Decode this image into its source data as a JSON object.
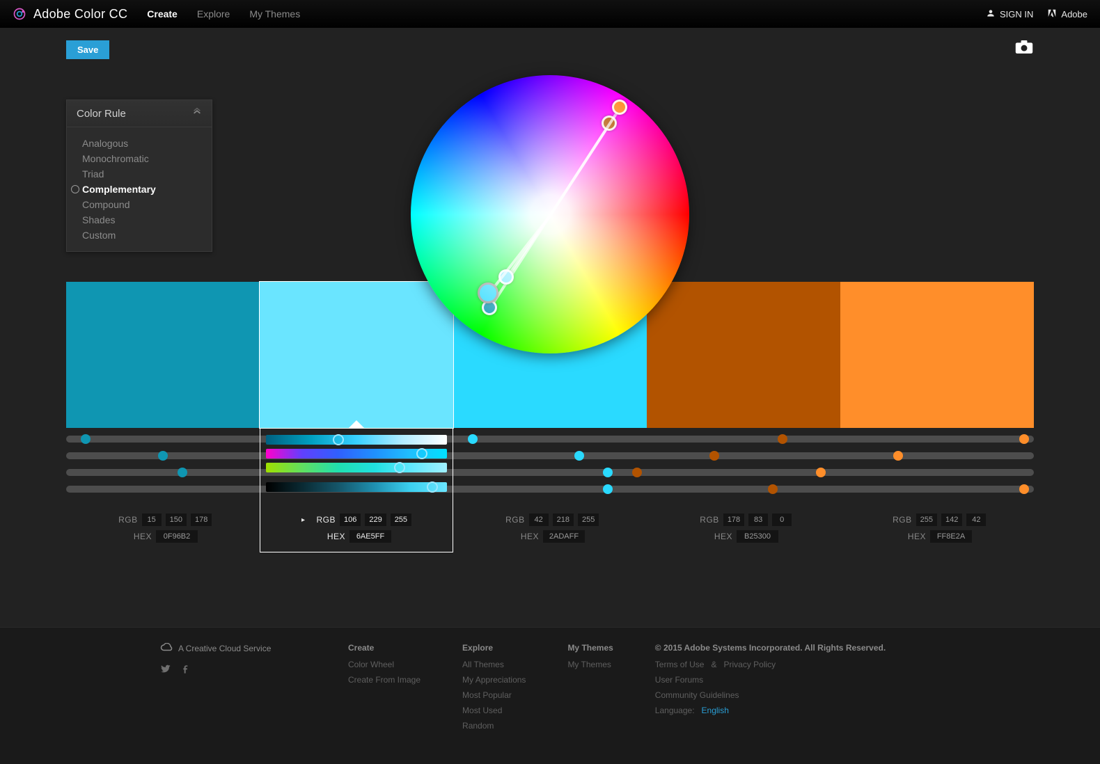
{
  "header": {
    "product_name": "Adobe Color CC",
    "nav": [
      {
        "label": "Create",
        "active": true
      },
      {
        "label": "Explore",
        "active": false
      },
      {
        "label": "My Themes",
        "active": false
      }
    ],
    "signin_label": "SIGN IN",
    "adobe_label": "Adobe"
  },
  "toolbar": {
    "save_label": "Save"
  },
  "color_rule": {
    "title": "Color Rule",
    "options": [
      "Analogous",
      "Monochromatic",
      "Triad",
      "Complementary",
      "Compound",
      "Shades",
      "Custom"
    ],
    "selected_index": 3
  },
  "swatches": [
    {
      "hex": "0F96B2",
      "rgb": [
        15,
        150,
        178
      ],
      "css": "#0F96B2"
    },
    {
      "hex": "6AE5FF",
      "rgb": [
        106,
        229,
        255
      ],
      "css": "#6AE5FF"
    },
    {
      "hex": "2ADAFF",
      "rgb": [
        42,
        218,
        255
      ],
      "css": "#2ADAFF"
    },
    {
      "hex": "B25300",
      "rgb": [
        178,
        83,
        0
      ],
      "css": "#B25300"
    },
    {
      "hex": "FF8E2A",
      "rgb": [
        255,
        142,
        42
      ],
      "css": "#FF8E2A"
    }
  ],
  "active_swatch_index": 1,
  "labels": {
    "rgb": "RGB",
    "hex": "HEX"
  },
  "wheel_handles": [
    {
      "angle": 237,
      "radius": 0.8,
      "color": "#0F96B2"
    },
    {
      "angle": 235,
      "radius": 0.55,
      "color": "#6AE5FF",
      "base": false
    },
    {
      "angle": 232,
      "radius": 0.72,
      "color": "#2ADAFF",
      "base": true
    },
    {
      "angle": 57,
      "radius": 0.78,
      "color": "#B25300"
    },
    {
      "angle": 57,
      "radius": 0.92,
      "color": "#FF8E2A"
    }
  ],
  "sliders": {
    "rows": [
      {
        "dots": [
          {
            "pos": 2,
            "color": "#0F96B2"
          },
          {
            "pos": 42,
            "color": "#2ADAFF"
          },
          {
            "pos": 74,
            "color": "#B25300"
          },
          {
            "pos": 99,
            "color": "#FF8E2A"
          }
        ]
      },
      {
        "dots": [
          {
            "pos": 10,
            "color": "#0F96B2"
          },
          {
            "pos": 53,
            "color": "#2ADAFF"
          },
          {
            "pos": 67,
            "color": "#B25300"
          },
          {
            "pos": 86,
            "color": "#FF8E2A"
          }
        ]
      },
      {
        "dots": [
          {
            "pos": 12,
            "color": "#0F96B2"
          },
          {
            "pos": 56,
            "color": "#2ADAFF"
          },
          {
            "pos": 59,
            "color": "#B25300"
          },
          {
            "pos": 78,
            "color": "#FF8E2A"
          }
        ]
      },
      {
        "dots": [
          {
            "pos": 56,
            "color": "#2ADAFF"
          },
          {
            "pos": 73,
            "color": "#B25300"
          },
          {
            "pos": 99,
            "color": "#FF8E2A"
          }
        ]
      }
    ],
    "active_grad_positions": [
      40,
      86,
      74,
      92
    ]
  },
  "footer": {
    "tagline": "A Creative Cloud Service",
    "columns": [
      {
        "title": "Create",
        "links": [
          "Color Wheel",
          "Create From Image"
        ]
      },
      {
        "title": "Explore",
        "links": [
          "All Themes",
          "My Appreciations",
          "Most Popular",
          "Most Used",
          "Random"
        ]
      },
      {
        "title": "My Themes",
        "links": [
          "My Themes"
        ]
      }
    ],
    "copyright": "© 2015 Adobe Systems Incorporated. All Rights Reserved.",
    "legal_links": [
      "Terms of Use",
      "&",
      "Privacy Policy"
    ],
    "more_links": [
      "User Forums",
      "Community Guidelines"
    ],
    "language_label": "Language:",
    "language_value": "English"
  }
}
